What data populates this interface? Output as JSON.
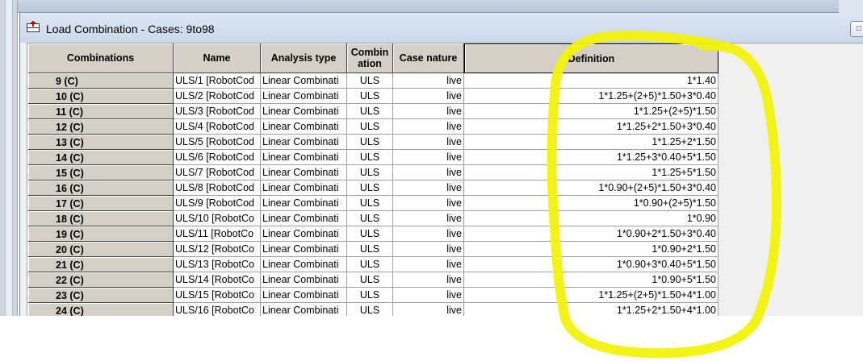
{
  "window": {
    "title": "Load Combination - Cases:  9to98",
    "title_button": "□"
  },
  "table": {
    "headers": {
      "combinations": "Combinations",
      "name": "Name",
      "analysis_type": "Analysis type",
      "combination_line1": "Combin",
      "combination_line2": "ation",
      "case_nature": "Case nature",
      "definition": "Definition"
    },
    "rows": [
      {
        "id": "9 (C)",
        "name": "ULS/1 [RobotCod",
        "analysis": "Linear Combinati",
        "comb": "ULS",
        "nature": "live",
        "definition": "1*1.40"
      },
      {
        "id": "10 (C)",
        "name": "ULS/2 [RobotCod",
        "analysis": "Linear Combinati",
        "comb": "ULS",
        "nature": "live",
        "definition": "1*1.25+(2+5)*1.50+3*0.40"
      },
      {
        "id": "11 (C)",
        "name": "ULS/3 [RobotCod",
        "analysis": "Linear Combinati",
        "comb": "ULS",
        "nature": "live",
        "definition": "1*1.25+(2+5)*1.50"
      },
      {
        "id": "12 (C)",
        "name": "ULS/4 [RobotCod",
        "analysis": "Linear Combinati",
        "comb": "ULS",
        "nature": "live",
        "definition": "1*1.25+2*1.50+3*0.40"
      },
      {
        "id": "13 (C)",
        "name": "ULS/5 [RobotCod",
        "analysis": "Linear Combinati",
        "comb": "ULS",
        "nature": "live",
        "definition": "1*1.25+2*1.50"
      },
      {
        "id": "14 (C)",
        "name": "ULS/6 [RobotCod",
        "analysis": "Linear Combinati",
        "comb": "ULS",
        "nature": "live",
        "definition": "1*1.25+3*0.40+5*1.50"
      },
      {
        "id": "15 (C)",
        "name": "ULS/7 [RobotCod",
        "analysis": "Linear Combinati",
        "comb": "ULS",
        "nature": "live",
        "definition": "1*1.25+5*1.50"
      },
      {
        "id": "16 (C)",
        "name": "ULS/8 [RobotCod",
        "analysis": "Linear Combinati",
        "comb": "ULS",
        "nature": "live",
        "definition": "1*0.90+(2+5)*1.50+3*0.40"
      },
      {
        "id": "17 (C)",
        "name": "ULS/9 [RobotCod",
        "analysis": "Linear Combinati",
        "comb": "ULS",
        "nature": "live",
        "definition": "1*0.90+(2+5)*1.50"
      },
      {
        "id": "18 (C)",
        "name": "ULS/10 [RobotCo",
        "analysis": "Linear Combinati",
        "comb": "ULS",
        "nature": "live",
        "definition": "1*0.90"
      },
      {
        "id": "19 (C)",
        "name": "ULS/11 [RobotCo",
        "analysis": "Linear Combinati",
        "comb": "ULS",
        "nature": "live",
        "definition": "1*0.90+2*1.50+3*0.40"
      },
      {
        "id": "20 (C)",
        "name": "ULS/12 [RobotCo",
        "analysis": "Linear Combinati",
        "comb": "ULS",
        "nature": "live",
        "definition": "1*0.90+2*1.50"
      },
      {
        "id": "21 (C)",
        "name": "ULS/13 [RobotCo",
        "analysis": "Linear Combinati",
        "comb": "ULS",
        "nature": "live",
        "definition": "1*0.90+3*0.40+5*1.50"
      },
      {
        "id": "22 (C)",
        "name": "ULS/14 [RobotCo",
        "analysis": "Linear Combinati",
        "comb": "ULS",
        "nature": "live",
        "definition": "1*0.90+5*1.50"
      },
      {
        "id": "23 (C)",
        "name": "ULS/15 [RobotCo",
        "analysis": "Linear Combinati",
        "comb": "ULS",
        "nature": "live",
        "definition": "1*1.25+(2+5)*1.50+4*1.00"
      },
      {
        "id": "24 (C)",
        "name": "ULS/16 [RobotCo",
        "analysis": "Linear Combinati",
        "comb": "ULS",
        "nature": "live",
        "definition": "1*1.25+2*1.50+4*1.00"
      }
    ]
  },
  "colors": {
    "highlighter": "#f2f20a",
    "header_bg": "#d4d0c8",
    "window_bg": "#f0f0f0"
  }
}
